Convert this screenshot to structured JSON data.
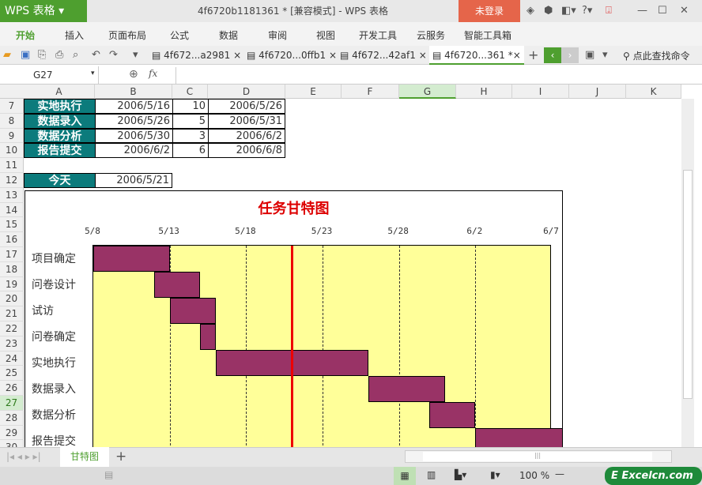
{
  "app": {
    "logo": "WPS 表格",
    "title": "4f6720b1181361 * [兼容模式] - WPS 表格",
    "login": "未登录"
  },
  "menu": [
    "开始",
    "插入",
    "页面布局",
    "公式",
    "数据",
    "审阅",
    "视图",
    "开发工具",
    "云服务",
    "智能工具箱"
  ],
  "doc_tabs": [
    "4f672...a2981",
    "4f6720...0ffb1",
    "4f672...42af1",
    "4f6720...361 *"
  ],
  "search_cmd": "点此查找命令",
  "formula": {
    "name_box": "G27",
    "fx": "fx",
    "value": ""
  },
  "columns": [
    "A",
    "B",
    "C",
    "D",
    "E",
    "F",
    "G",
    "H",
    "I",
    "J",
    "K"
  ],
  "rows": [
    "7",
    "8",
    "9",
    "10",
    "11",
    "12",
    "13",
    "14",
    "15",
    "16",
    "17",
    "18",
    "19",
    "20",
    "21",
    "22",
    "23",
    "24",
    "25",
    "26",
    "27",
    "28",
    "29",
    "30"
  ],
  "table": [
    {
      "task": "实地执行",
      "start": "2006/5/16",
      "days": "10",
      "end": "2006/5/26"
    },
    {
      "task": "数据录入",
      "start": "2006/5/26",
      "days": "5",
      "end": "2006/5/31"
    },
    {
      "task": "数据分析",
      "start": "2006/5/30",
      "days": "3",
      "end": "2006/6/2"
    },
    {
      "task": "报告提交",
      "start": "2006/6/2",
      "days": "6",
      "end": "2006/6/8"
    }
  ],
  "today": {
    "label": "今天",
    "value": "2006/5/21"
  },
  "chart_data": {
    "type": "bar",
    "title": "任务甘特图",
    "x_ticks": [
      "5/8",
      "5/13",
      "5/18",
      "5/23",
      "5/28",
      "6/2",
      "6/7"
    ],
    "x_start_day": 0,
    "x_end_day": 30,
    "x_tick_step": 5,
    "today_day": 13,
    "tasks": [
      {
        "name": "项目确定",
        "start": 0,
        "duration": 5
      },
      {
        "name": "问卷设计",
        "start": 4,
        "duration": 3
      },
      {
        "name": "试访",
        "start": 5,
        "duration": 3
      },
      {
        "name": "问卷确定",
        "start": 7,
        "duration": 1
      },
      {
        "name": "实地执行",
        "start": 8,
        "duration": 10
      },
      {
        "name": "数据录入",
        "start": 18,
        "duration": 5
      },
      {
        "name": "数据分析",
        "start": 22,
        "duration": 3
      },
      {
        "name": "报告提交",
        "start": 25,
        "duration": 6
      }
    ],
    "colors": {
      "bar": "#993366",
      "plot_bg": "#ffff99",
      "today": "#ee0000"
    }
  },
  "sheet_tab": "甘特图",
  "status": {
    "zoom": "100 %",
    "brand": "Excelcn.com"
  }
}
